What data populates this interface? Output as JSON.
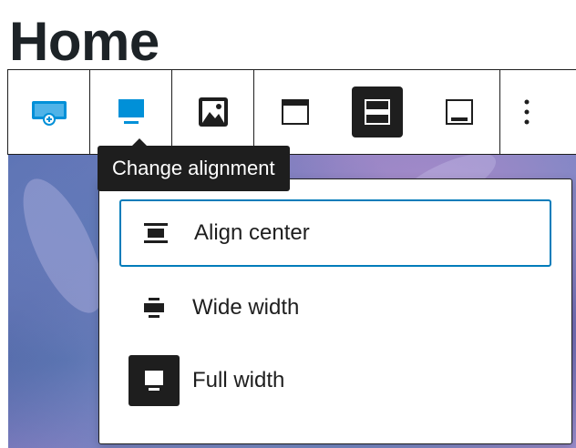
{
  "page": {
    "title": "Home"
  },
  "toolbar": {
    "buttons": [
      {
        "name": "cover-block",
        "icon": "cover-icon",
        "color": "#0090d8"
      },
      {
        "name": "change-alignment",
        "icon": "align-full-icon",
        "color": "#0090d8",
        "active": true
      },
      {
        "name": "replace-media",
        "icon": "image-icon"
      },
      {
        "name": "content-position-top",
        "icon": "position-top-icon"
      },
      {
        "name": "content-position-center",
        "icon": "position-center-icon",
        "pressed": true
      },
      {
        "name": "content-position-bottom",
        "icon": "position-bottom-icon"
      },
      {
        "name": "more-options",
        "icon": "more-vertical-icon"
      }
    ]
  },
  "tooltip": {
    "text": "Change alignment"
  },
  "menu": {
    "items": [
      {
        "label": "Align center",
        "icon": "align-center-icon",
        "focused": true
      },
      {
        "label": "Wide width",
        "icon": "align-wide-icon"
      },
      {
        "label": "Full width",
        "icon": "align-full-width-icon",
        "selected": true
      }
    ]
  },
  "colors": {
    "accent": "#007cba",
    "dark": "#1e1e1e",
    "title": "#1d2327"
  }
}
